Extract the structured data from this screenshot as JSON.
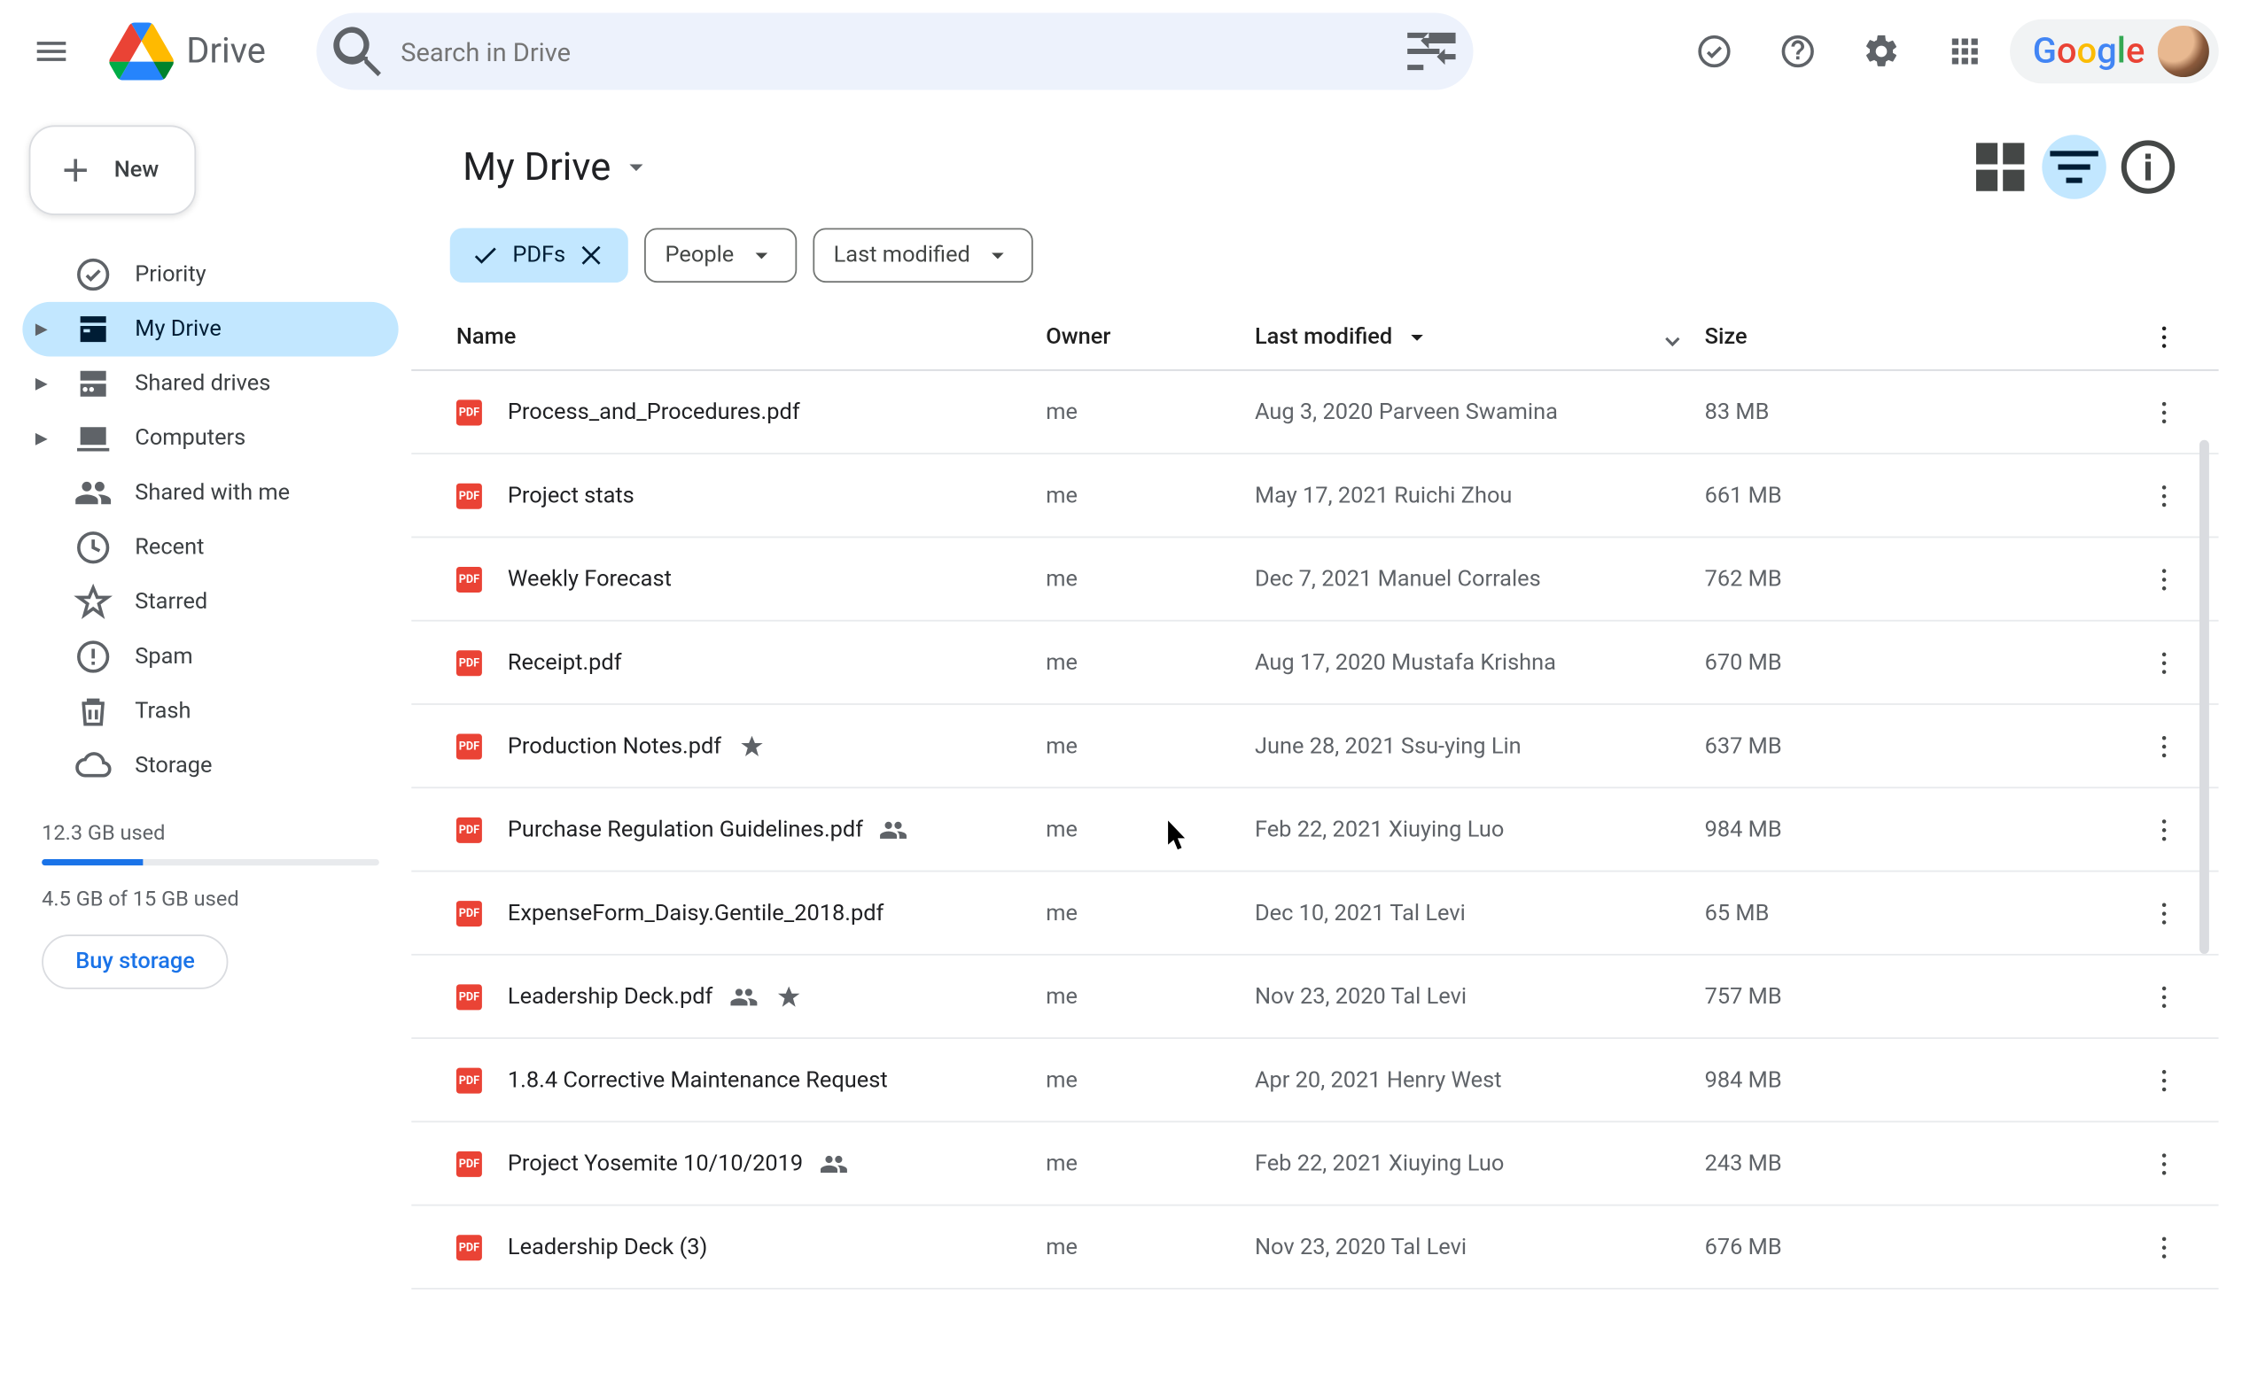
{
  "header": {
    "app_name": "Drive",
    "search_placeholder": "Search in Drive",
    "google_word": "Google"
  },
  "sidebar": {
    "new_label": "New",
    "items": [
      {
        "label": "Priority"
      },
      {
        "label": "My Drive"
      },
      {
        "label": "Shared drives"
      },
      {
        "label": "Computers"
      },
      {
        "label": "Shared with me"
      },
      {
        "label": "Recent"
      },
      {
        "label": "Starred"
      },
      {
        "label": "Spam"
      },
      {
        "label": "Trash"
      },
      {
        "label": "Storage"
      }
    ],
    "storage": {
      "used_label": "12.3 GB used",
      "detail_label": "4.5 GB of 15 GB used",
      "buy_label": "Buy storage",
      "percent": 30
    }
  },
  "main": {
    "title": "My Drive",
    "chips": {
      "active_filter_label": "PDFs",
      "people_label": "People",
      "modified_label": "Last modified"
    },
    "columns": {
      "name": "Name",
      "owner": "Owner",
      "modified": "Last modified",
      "size": "Size"
    },
    "pdf_badge": "PDF",
    "rows": [
      {
        "name": "Process_and_Procedures.pdf",
        "owner": "me",
        "modified": "Aug 3, 2020 Parveen Swamina",
        "size": "83 MB",
        "shared": false,
        "starred": false
      },
      {
        "name": "Project stats",
        "owner": "me",
        "modified": "May 17, 2021 Ruichi Zhou",
        "size": "661 MB",
        "shared": false,
        "starred": false
      },
      {
        "name": "Weekly Forecast",
        "owner": "me",
        "modified": "Dec 7, 2021 Manuel Corrales",
        "size": "762 MB",
        "shared": false,
        "starred": false
      },
      {
        "name": "Receipt.pdf",
        "owner": "me",
        "modified": "Aug 17, 2020 Mustafa Krishna",
        "size": "670 MB",
        "shared": false,
        "starred": false
      },
      {
        "name": "Production Notes.pdf",
        "owner": "me",
        "modified": "June 28, 2021 Ssu-ying Lin",
        "size": "637 MB",
        "shared": false,
        "starred": true
      },
      {
        "name": "Purchase Regulation Guidelines.pdf",
        "owner": "me",
        "modified": "Feb 22, 2021 Xiuying Luo",
        "size": "984 MB",
        "shared": true,
        "starred": false
      },
      {
        "name": "ExpenseForm_Daisy.Gentile_2018.pdf",
        "owner": "me",
        "modified": "Dec 10, 2021 Tal Levi",
        "size": "65 MB",
        "shared": false,
        "starred": false
      },
      {
        "name": "Leadership Deck.pdf",
        "owner": "me",
        "modified": "Nov 23, 2020 Tal Levi",
        "size": "757 MB",
        "shared": true,
        "starred": true
      },
      {
        "name": "1.8.4 Corrective Maintenance Request",
        "owner": "me",
        "modified": "Apr 20, 2021 Henry West",
        "size": "984 MB",
        "shared": false,
        "starred": false
      },
      {
        "name": "Project Yosemite 10/10/2019",
        "owner": "me",
        "modified": "Feb 22, 2021 Xiuying Luo",
        "size": "243 MB",
        "shared": true,
        "starred": false
      },
      {
        "name": "Leadership Deck (3)",
        "owner": "me",
        "modified": "Nov 23, 2020 Tal Levi",
        "size": "676 MB",
        "shared": false,
        "starred": false
      }
    ]
  }
}
